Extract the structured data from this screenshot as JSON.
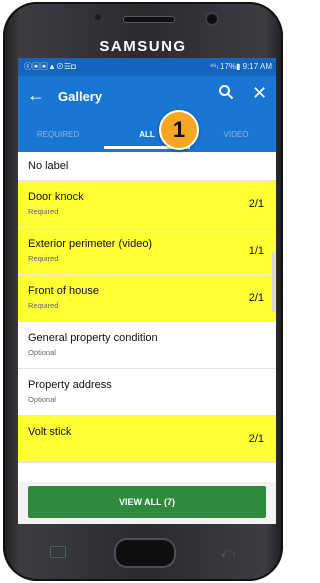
{
  "device": {
    "brand": "SAMSUNG"
  },
  "status_bar": {
    "left_icons": "ⓒ▣▣▲⊘☰◘",
    "right_text": "⁴⁶ₗ 17%▮ 9:17 AM"
  },
  "app_bar": {
    "title": "Gallery",
    "back_glyph": "←",
    "close_glyph": "✕"
  },
  "tabs": [
    {
      "label": "REQUIRED"
    },
    {
      "label": "ALL",
      "selected": true
    },
    {
      "label": "VIDEO"
    }
  ],
  "callout": {
    "number": "1",
    "color": "#f5a623"
  },
  "list": {
    "items": [
      {
        "label": "No label",
        "sub": "",
        "count": ""
      },
      {
        "label": "Door knock",
        "sub": "Required",
        "count": "2/1"
      },
      {
        "label": "Exterior perimeter (video)",
        "sub": "Required",
        "count": "1/1"
      },
      {
        "label": "Front of house",
        "sub": "Required",
        "count": "2/1"
      },
      {
        "label": "General property condition",
        "sub": "Optional",
        "count": ""
      },
      {
        "label": "Property address",
        "sub": "Optional",
        "count": ""
      },
      {
        "label": "Volt stick",
        "sub": "",
        "count": "2/1"
      }
    ]
  },
  "colors": {
    "primary": "#1976d2",
    "highlight": "#ffff33",
    "action": "#2e8b3e"
  },
  "actions": {
    "view_all": "VIEW ALL (7)"
  }
}
